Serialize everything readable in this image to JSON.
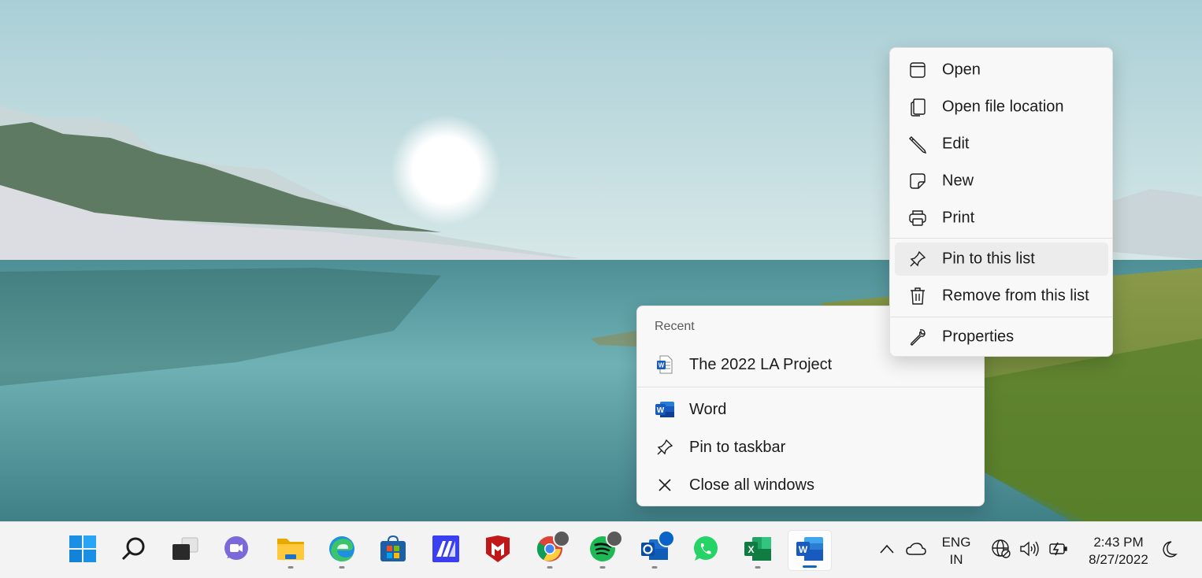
{
  "jumplist": {
    "header": "Recent",
    "recent_items": [
      {
        "label": "The 2022 LA Project",
        "icon": "word-document-icon"
      }
    ],
    "tasks": [
      {
        "label": "Word",
        "icon": "word-app-icon"
      },
      {
        "label": "Pin to taskbar",
        "icon": "pin-icon"
      },
      {
        "label": "Close all windows",
        "icon": "close-icon"
      }
    ]
  },
  "context_menu": {
    "items": [
      {
        "label": "Open",
        "icon": "window-icon"
      },
      {
        "label": "Open file location",
        "icon": "file-copy-icon"
      },
      {
        "label": "Edit",
        "icon": "pencil-icon"
      },
      {
        "label": "New",
        "icon": "new-note-icon"
      },
      {
        "label": "Print",
        "icon": "printer-icon"
      },
      {
        "label": "Pin to this list",
        "icon": "pin-icon",
        "highlighted": true
      },
      {
        "label": "Remove from this list",
        "icon": "trash-icon"
      },
      {
        "label": "Properties",
        "icon": "wrench-icon"
      }
    ]
  },
  "taskbar": {
    "apps": [
      {
        "name": "start",
        "icon": "windows-logo-icon",
        "running": false
      },
      {
        "name": "search",
        "icon": "search-icon",
        "running": false
      },
      {
        "name": "task-view",
        "icon": "task-view-icon",
        "running": false
      },
      {
        "name": "chat",
        "icon": "teams-chat-icon",
        "running": false
      },
      {
        "name": "file-explorer",
        "icon": "folder-icon",
        "running": true
      },
      {
        "name": "edge",
        "icon": "edge-icon",
        "running": true
      },
      {
        "name": "store",
        "icon": "store-icon",
        "running": false
      },
      {
        "name": "app-m",
        "icon": "m-app-icon",
        "running": false
      },
      {
        "name": "mcafee",
        "icon": "mcafee-icon",
        "running": false
      },
      {
        "name": "chrome",
        "icon": "chrome-icon",
        "running": true
      },
      {
        "name": "spotify",
        "icon": "spotify-icon",
        "running": true
      },
      {
        "name": "outlook",
        "icon": "outlook-icon",
        "running": true
      },
      {
        "name": "whatsapp",
        "icon": "whatsapp-icon",
        "running": false
      },
      {
        "name": "excel",
        "icon": "excel-icon",
        "running": true
      },
      {
        "name": "word",
        "icon": "word-app-icon",
        "running": true,
        "active": true
      }
    ],
    "tray": {
      "language_top": "ENG",
      "language_bottom": "IN",
      "time": "2:43 PM",
      "date": "8/27/2022"
    }
  },
  "colors": {
    "word_blue": "#185abd",
    "excel_green": "#107c41",
    "accent": "#0f6cbd",
    "menu_bg": "#f8f8f8"
  }
}
